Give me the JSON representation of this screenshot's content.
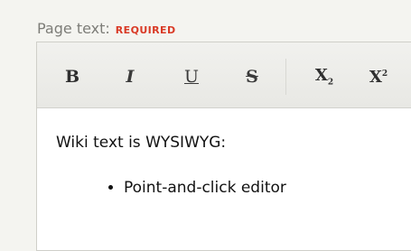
{
  "field": {
    "label": "Page text:",
    "required": "REQUIRED"
  },
  "toolbar": {
    "bold": "B",
    "italic": "I",
    "underline": "U",
    "strikethrough": "S",
    "subscript_base": "X",
    "subscript_mark": "2",
    "superscript_base": "X",
    "superscript_mark": "2"
  },
  "content": {
    "intro": "Wiki text is WYSIWYG:",
    "bullets": [
      "Point-and-click editor"
    ]
  },
  "colors": {
    "required": "#d93a26",
    "label": "#7d7d78"
  }
}
